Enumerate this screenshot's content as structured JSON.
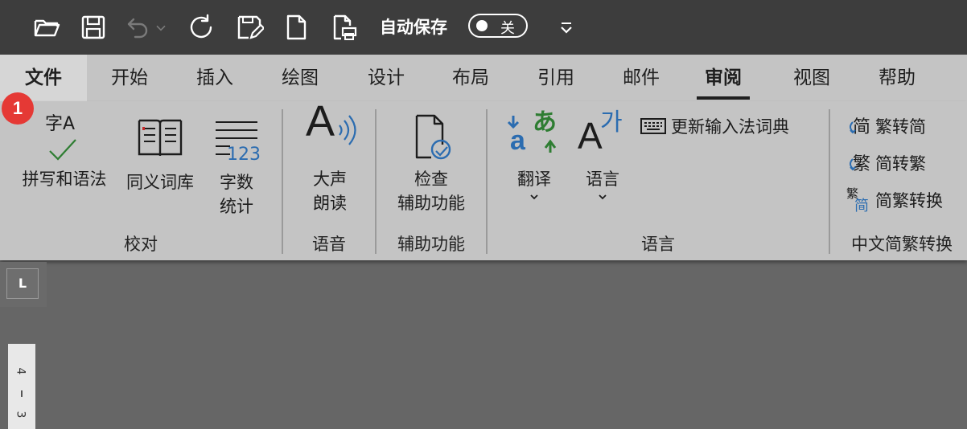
{
  "quick_access": {
    "autosave_label": "自动保存",
    "autosave_state": "关"
  },
  "tabs": [
    {
      "label": "文件"
    },
    {
      "label": "开始"
    },
    {
      "label": "插入"
    },
    {
      "label": "绘图"
    },
    {
      "label": "设计"
    },
    {
      "label": "布局"
    },
    {
      "label": "引用"
    },
    {
      "label": "邮件"
    },
    {
      "label": "审阅"
    },
    {
      "label": "视图"
    },
    {
      "label": "帮助"
    }
  ],
  "badge": "1",
  "ribbon": {
    "proofing": {
      "group_label": "校对",
      "spelling": "拼写和语法",
      "thesaurus": "同义词库",
      "word_count_l1": "字数",
      "word_count_l2": "统计",
      "spelling_icon_text": "字A",
      "word_count_icon_text": "123"
    },
    "speech": {
      "group_label": "语音",
      "read_aloud_l1": "大声",
      "read_aloud_l2": "朗读",
      "icon_text": "A"
    },
    "accessibility": {
      "group_label": "辅助功能",
      "check_l1": "检查",
      "check_l2": "辅助功能"
    },
    "language": {
      "group_label": "语言",
      "translate": "翻译",
      "language": "语言",
      "update_ime": "更新输入法词典",
      "translate_icon_a": "a",
      "translate_icon_b": "あ",
      "language_icon_a": "A",
      "language_icon_b": "가"
    },
    "chinese_conversion": {
      "group_label": "中文简繁转换",
      "to_simplified": "繁转简",
      "to_traditional": "简转繁",
      "convert": "简繁转换",
      "icon_simplified": "简",
      "icon_traditional": "繁"
    }
  },
  "ruler": {
    "corner": "L",
    "marks": [
      "4",
      "3"
    ]
  },
  "colors": {
    "toolbar_bg": "#3d3d3d",
    "ribbon_bg": "#c4c4c4",
    "document_bg": "#666666",
    "badge": "#e53935",
    "accent_blue": "#2b6cb0",
    "accent_green": "#2e7d32"
  }
}
